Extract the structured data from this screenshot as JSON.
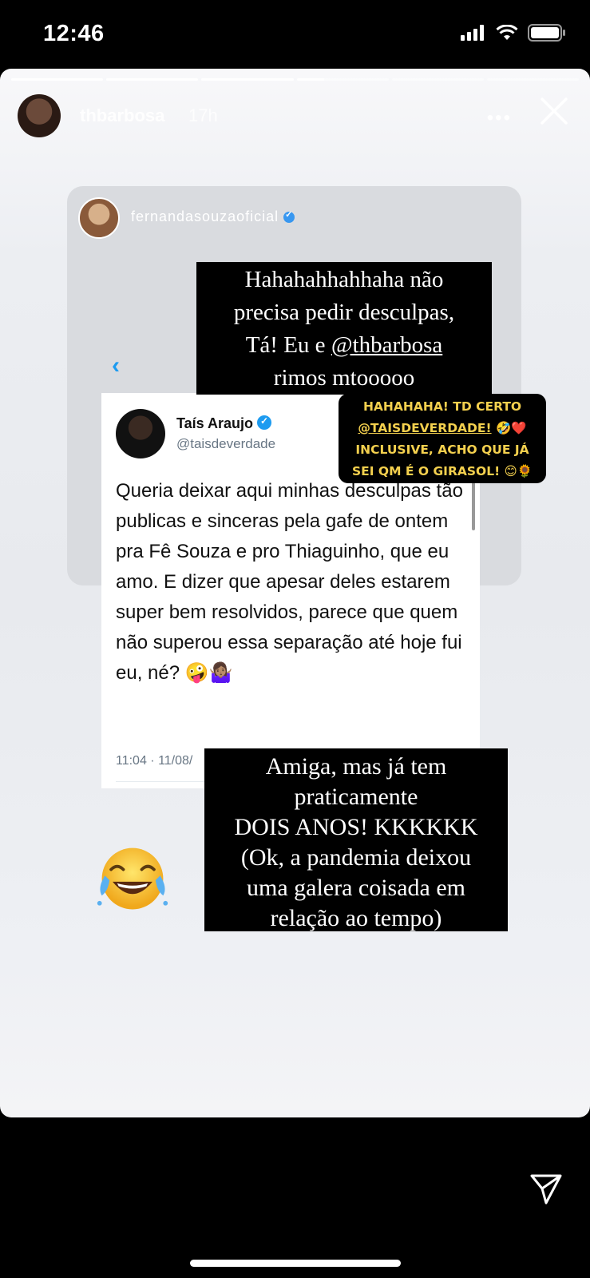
{
  "status_bar": {
    "time": "12:46",
    "icons": [
      "signal-icon",
      "wifi-icon",
      "battery-icon"
    ]
  },
  "story": {
    "progress": [
      1,
      1,
      1,
      0.3,
      0,
      0
    ],
    "username": "thbarbosa",
    "time_ago": "17h",
    "more_icon": "ellipsis-icon",
    "close_icon": "close-icon"
  },
  "screenshot_card": {
    "username": "fernandasouzaoficial",
    "back_icon": "chevron-left-icon"
  },
  "tweet": {
    "name": "Taís Araujo",
    "handle": "@taisdeverdade",
    "text": "Queria deixar aqui minhas desculpas tão publicas e sinceras pela gafe de ontem pra Fê Souza e pro Thiaguinho, que eu amo. E dizer que apesar deles estarem super bem resolvidos, parece que quem não superou essa separação até hoje fui eu, né? 🤪🤷🏽‍♀️",
    "date": "11:04 · 11/08/"
  },
  "caption_1": {
    "line1": "Hahahahhahhaha não",
    "line2": "precisa pedir desculpas,",
    "line3_prefix": "Tá! Eu e ",
    "line3_mention": "@thbarbosa",
    "line4": "rimos mtooooo"
  },
  "sticker": {
    "line1": "HAHAHAHA! TD CERTO",
    "line2_mention": "@TAISDEVERDADE!",
    "line2_emoji": " 🤣❤️",
    "line3": "INCLUSIVE, ACHO QUE JÁ",
    "line4": "SEI QM É O GIRASOL! 😊🌻"
  },
  "caption_2": {
    "line1": "Amiga, mas já tem",
    "line2": "praticamente",
    "line3": "DOIS ANOS! KKKKKK",
    "line4": "(Ok, a pandemia deixou",
    "line5": "uma galera coisada em",
    "line6": "relação ao tempo)"
  },
  "emoji_sticker": "laughing-crying-emoji",
  "footer": {
    "send_icon": "send-icon"
  }
}
